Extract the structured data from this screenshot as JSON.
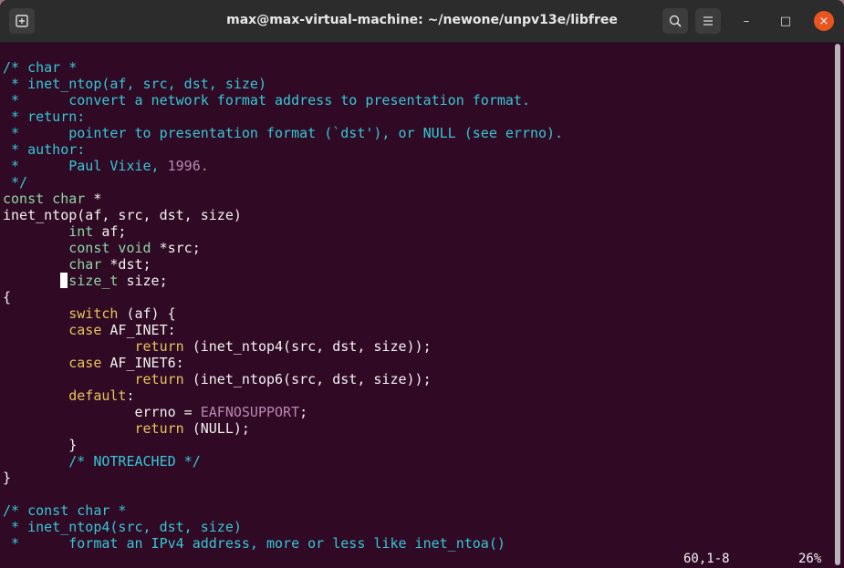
{
  "window": {
    "title": "max@max-virtual-machine: ~/newone/unpv13e/libfree",
    "buttons": {
      "new_tab": "new-tab-icon",
      "search": "search-icon",
      "menu": "hamburger-menu-icon",
      "minimize": "–",
      "maximize": "□",
      "close": "×"
    }
  },
  "colors": {
    "background": "#300a24",
    "comment": "#34c7d6",
    "type": "#8cd6a4",
    "keyword": "#e6c25a",
    "constant": "#b888b4",
    "close_button": "#e95420"
  },
  "editor": {
    "lines": [
      [
        [
          "/* char *",
          "comment"
        ]
      ],
      [
        [
          " * inet_ntop(af, src, dst, size)",
          "comment"
        ]
      ],
      [
        [
          " *      convert a network format address to presentation format.",
          "comment"
        ]
      ],
      [
        [
          " * return:",
          "comment"
        ]
      ],
      [
        [
          " *      pointer to presentation format (`dst'), or NULL (see errno).",
          "comment"
        ]
      ],
      [
        [
          " * author:",
          "comment"
        ]
      ],
      [
        [
          " *      Paul Vixie, ",
          "comment"
        ],
        [
          "1996.",
          "constant"
        ]
      ],
      [
        [
          " */",
          "comment"
        ]
      ],
      [
        [
          "const char",
          "type"
        ],
        [
          " *",
          "normal"
        ]
      ],
      [
        [
          "inet_ntop(af, src, dst, size)",
          "normal"
        ]
      ],
      [
        [
          "        ",
          "normal"
        ],
        [
          "int",
          "type"
        ],
        [
          " af;",
          "normal"
        ]
      ],
      [
        [
          "        ",
          "normal"
        ],
        [
          "const void",
          "type"
        ],
        [
          " *src;",
          "normal"
        ]
      ],
      [
        [
          "        ",
          "normal"
        ],
        [
          "char",
          "type"
        ],
        [
          " *dst;",
          "normal"
        ]
      ],
      [
        [
          "        ",
          "normal"
        ],
        [
          "size_t",
          "type"
        ],
        [
          " size;",
          "normal"
        ]
      ],
      [
        [
          "{",
          "normal"
        ]
      ],
      [
        [
          "        ",
          "normal"
        ],
        [
          "switch",
          "keyword"
        ],
        [
          " (af) {",
          "normal"
        ]
      ],
      [
        [
          "        ",
          "normal"
        ],
        [
          "case",
          "keyword"
        ],
        [
          " AF_INET:",
          "normal"
        ]
      ],
      [
        [
          "                ",
          "normal"
        ],
        [
          "return",
          "keyword"
        ],
        [
          " (inet_ntop4(src, dst, size));",
          "normal"
        ]
      ],
      [
        [
          "        ",
          "normal"
        ],
        [
          "case",
          "keyword"
        ],
        [
          " AF_INET6:",
          "normal"
        ]
      ],
      [
        [
          "                ",
          "normal"
        ],
        [
          "return",
          "keyword"
        ],
        [
          " (inet_ntop6(src, dst, size));",
          "normal"
        ]
      ],
      [
        [
          "        ",
          "normal"
        ],
        [
          "default",
          "keyword"
        ],
        [
          ":",
          "normal"
        ]
      ],
      [
        [
          "                errno = ",
          "normal"
        ],
        [
          "EAFNOSUPPORT",
          "constant"
        ],
        [
          ";",
          "normal"
        ]
      ],
      [
        [
          "                ",
          "normal"
        ],
        [
          "return",
          "keyword"
        ],
        [
          " (NULL);",
          "normal"
        ]
      ],
      [
        [
          "        }",
          "normal"
        ]
      ],
      [
        [
          "        ",
          "normal"
        ],
        [
          "/* NOTREACHED */",
          "comment"
        ]
      ],
      [
        [
          "}",
          "normal"
        ]
      ],
      [
        [
          "",
          "normal"
        ]
      ],
      [
        [
          "/* const char *",
          "comment"
        ]
      ],
      [
        [
          " * inet_ntop4(src, dst, size)",
          "comment"
        ]
      ],
      [
        [
          " *      format an IPv4 address, more or less like inet_ntoa()",
          "comment"
        ]
      ]
    ],
    "status": {
      "position": "60,1-8",
      "percent": "26%"
    }
  }
}
